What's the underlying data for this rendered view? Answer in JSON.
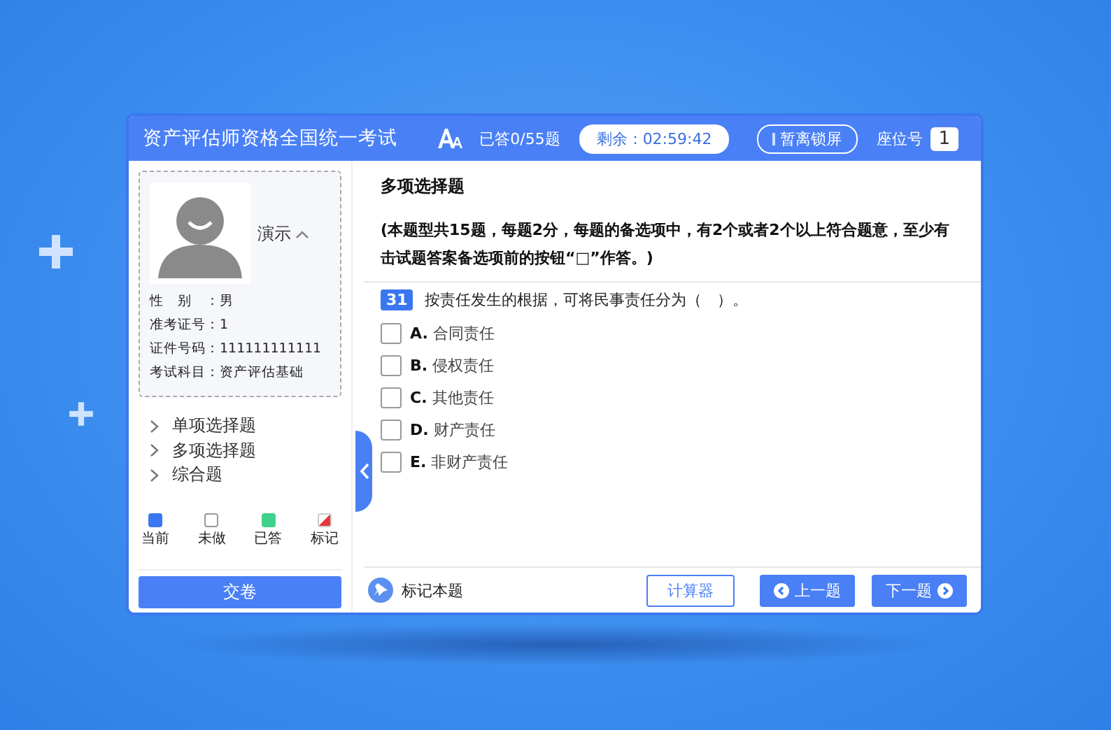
{
  "header": {
    "title": "资产评估师资格全国统一考试",
    "answered": "已答0/55题",
    "timer": "剩余：02:59:42",
    "lock_button": "暂离锁屏",
    "seat_label": "座位号",
    "seat_number": "1"
  },
  "candidate": {
    "name": "演示",
    "info": [
      {
        "label": "性　别　：",
        "value": "男"
      },
      {
        "label": "准考证号：",
        "value": "1"
      },
      {
        "label": "证件号码：",
        "value": "111111111111"
      },
      {
        "label": "考试科目：",
        "value": "资产评估基础"
      }
    ]
  },
  "sections": [
    {
      "label": "单项选择题"
    },
    {
      "label": "多项选择题"
    },
    {
      "label": "综合题"
    }
  ],
  "legend": [
    {
      "kind": "current",
      "label": "当前"
    },
    {
      "kind": "todo",
      "label": "未做"
    },
    {
      "kind": "done",
      "label": "已答"
    },
    {
      "kind": "marked",
      "label": "标记"
    }
  ],
  "submit_button": "交卷",
  "question": {
    "section_title": "多项选择题",
    "instructions": [
      "(本题型共15题，每题2分，每题的备选项中，有2个或者2个以上符合题意，至少有",
      "击试题答案备选项前的按钮“□”作答。)"
    ],
    "number": "31",
    "text": "按责任发生的根据，可将民事责任分为（　）。",
    "options": [
      {
        "letter": "A.",
        "text": "合同责任",
        "checked": false
      },
      {
        "letter": "B.",
        "text": "侵权责任",
        "checked": false
      },
      {
        "letter": "C.",
        "text": "其他责任",
        "checked": false
      },
      {
        "letter": "D.",
        "text": "财产责任",
        "checked": false
      },
      {
        "letter": "E.",
        "text": "非财产责任",
        "checked": false
      }
    ]
  },
  "footer": {
    "mark_label": "标记本题",
    "calculator_button": "计算器",
    "prev_button": "上一题",
    "next_button": "下一题"
  }
}
